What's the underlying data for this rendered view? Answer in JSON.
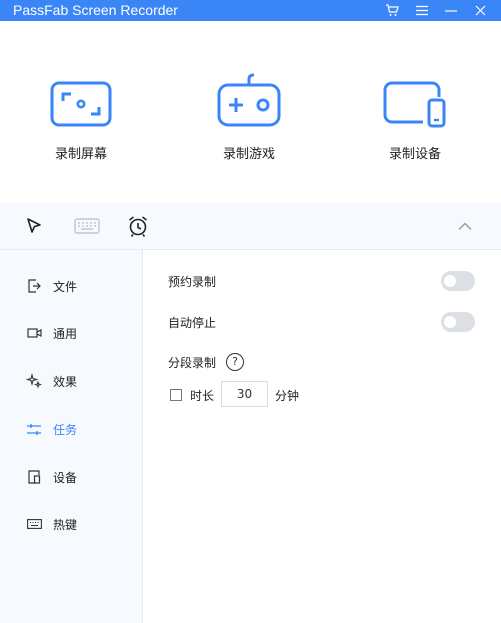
{
  "window": {
    "title": "PassFab Screen Recorder",
    "controls": [
      "cart-icon",
      "menu-icon",
      "minimize-icon",
      "close-icon"
    ]
  },
  "modes": [
    {
      "label": "录制屏幕",
      "icon": "screen-record-icon"
    },
    {
      "label": "录制游戏",
      "icon": "gamepad-icon"
    },
    {
      "label": "录制设备",
      "icon": "device-icon"
    }
  ],
  "toolbar": {
    "tools": [
      "cursor-icon",
      "keyboard-icon",
      "alarm-clock-icon"
    ],
    "collapse": "chevron-up-icon"
  },
  "sidebar": {
    "items": [
      {
        "label": "文件",
        "icon": "file-export-icon"
      },
      {
        "label": "通用",
        "icon": "camera-icon"
      },
      {
        "label": "效果",
        "icon": "sparkle-icon"
      },
      {
        "label": "任务",
        "icon": "sliders-icon",
        "active": true
      },
      {
        "label": "设备",
        "icon": "device-icon"
      },
      {
        "label": "热键",
        "icon": "keyboard-icon"
      }
    ]
  },
  "task_settings": {
    "scheduled_label": "预约录制",
    "scheduled_on": false,
    "auto_stop_label": "自动停止",
    "auto_stop_on": false,
    "segment_label": "分段录制",
    "help_glyph": "?",
    "duration_checked": false,
    "duration_label": "时长",
    "duration_value": "30",
    "duration_unit": "分钟"
  },
  "colors": {
    "accent": "#3b86f7",
    "panel_bg": "#f6f9fd",
    "toggle_off": "#dcdfe4"
  }
}
